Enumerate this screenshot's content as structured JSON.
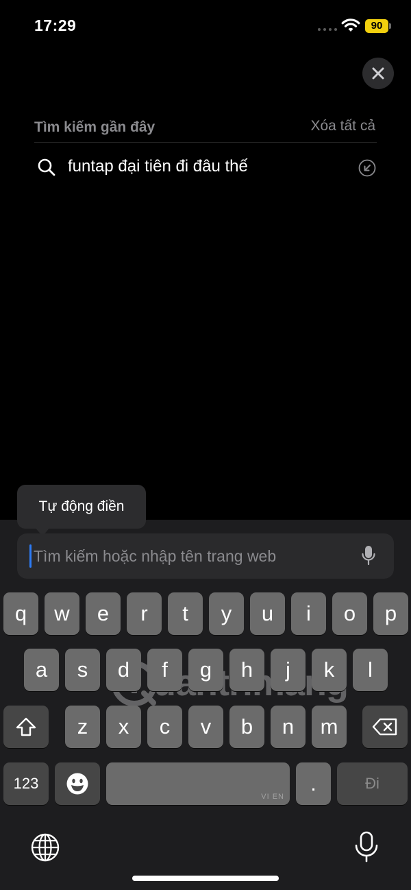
{
  "status_bar": {
    "time": "17:29",
    "battery": "90"
  },
  "recent": {
    "title": "Tìm kiếm gần đây",
    "clear_all": "Xóa tất cả",
    "items": [
      "funtap đại tiên đi đâu thế"
    ]
  },
  "autofill": {
    "label": "Tự động điền"
  },
  "search": {
    "placeholder": "Tìm kiếm hoặc nhập tên trang web"
  },
  "keyboard": {
    "row1": [
      "q",
      "w",
      "e",
      "r",
      "t",
      "y",
      "u",
      "i",
      "o",
      "p"
    ],
    "row2": [
      "a",
      "s",
      "d",
      "f",
      "g",
      "h",
      "j",
      "k",
      "l"
    ],
    "row3": [
      "z",
      "x",
      "c",
      "v",
      "b",
      "n",
      "m"
    ],
    "numbers_label": "123",
    "space_lang": "VI EN",
    "period": ".",
    "go_label": "Đi"
  },
  "watermark": {
    "text": "uantrimang"
  },
  "colors": {
    "accent": "#2d7cf6",
    "battery": "#f2d00e",
    "key": "#6b6b6b",
    "key_dark": "#464646"
  }
}
